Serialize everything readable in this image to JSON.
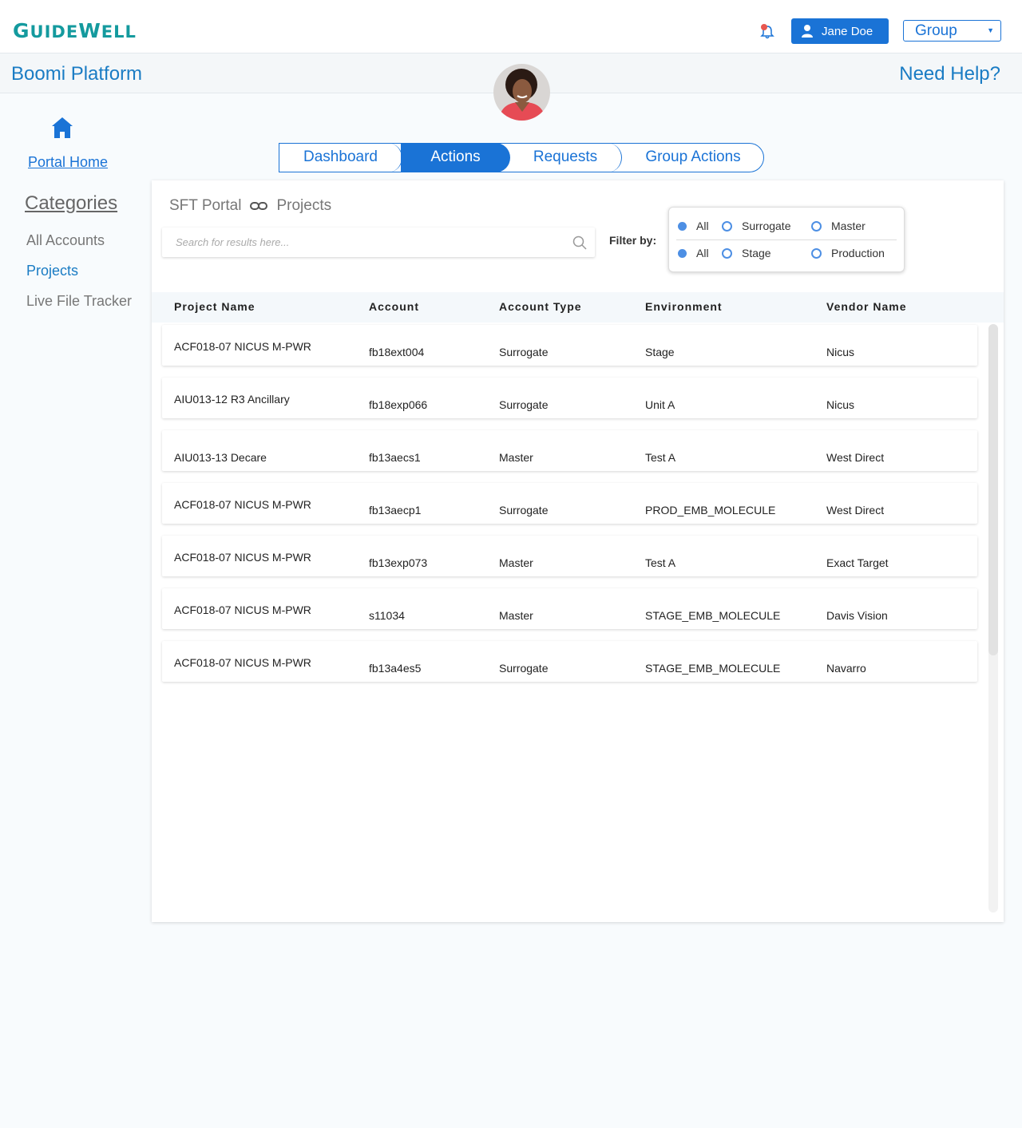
{
  "header": {
    "logo_text_first": "G",
    "logo_text_mid": "UIDE",
    "logo_text_w": "W",
    "logo_text_end": "ELL",
    "user_name": "Jane Doe",
    "group_select_value": "Group"
  },
  "subheader": {
    "title": "Boomi Platform",
    "help": "Need Help?"
  },
  "sidebar": {
    "home_label": "Portal Home",
    "categories_label": "Categories",
    "items": [
      {
        "label": "All Accounts"
      },
      {
        "label": "Projects"
      },
      {
        "label": "Live File Tracker"
      }
    ]
  },
  "tabs": [
    {
      "label": "Dashboard"
    },
    {
      "label": "Actions"
    },
    {
      "label": "Requests"
    },
    {
      "label": "Group Actions"
    }
  ],
  "breadcrumb": {
    "root": "SFT Portal",
    "current": "Projects"
  },
  "search": {
    "placeholder": "Search for results here..."
  },
  "filter": {
    "label": "Filter by:",
    "row1": [
      "All",
      "Surrogate",
      "Master"
    ],
    "row2": [
      "All",
      "Stage",
      "Production"
    ]
  },
  "table": {
    "columns": [
      "Project Name",
      "Account",
      "Account Type",
      "Environment",
      "Vendor Name"
    ],
    "rows": [
      [
        "ACF018-07 NICUS M-PWR",
        "fb18ext004",
        "Surrogate",
        "Stage",
        "Nicus"
      ],
      [
        "AIU013-12 R3 Ancillary",
        "fb18exp066",
        "Surrogate",
        "Unit A",
        "Nicus"
      ],
      [
        "AIU013-13 Decare",
        "fb13aecs1",
        "Master",
        "Test A",
        "West Direct"
      ],
      [
        "ACF018-07 NICUS M-PWR",
        "fb13aecp1",
        "Surrogate",
        "PROD_EMB_MOLECULE",
        "West Direct"
      ],
      [
        "ACF018-07 NICUS M-PWR",
        "fb13exp073",
        "Master",
        "Test A",
        "Exact Target"
      ],
      [
        "ACF018-07 NICUS M-PWR",
        "s11034",
        "Master",
        "STAGE_EMB_MOLECULE",
        "Davis Vision"
      ],
      [
        "ACF018-07 NICUS M-PWR",
        "fb13a4es5",
        "Surrogate",
        "STAGE_EMB_MOLECULE",
        "Navarro"
      ]
    ]
  },
  "colors": {
    "primary": "#1a73d6",
    "title": "#1a7cc4",
    "logo": "#149a9e"
  }
}
